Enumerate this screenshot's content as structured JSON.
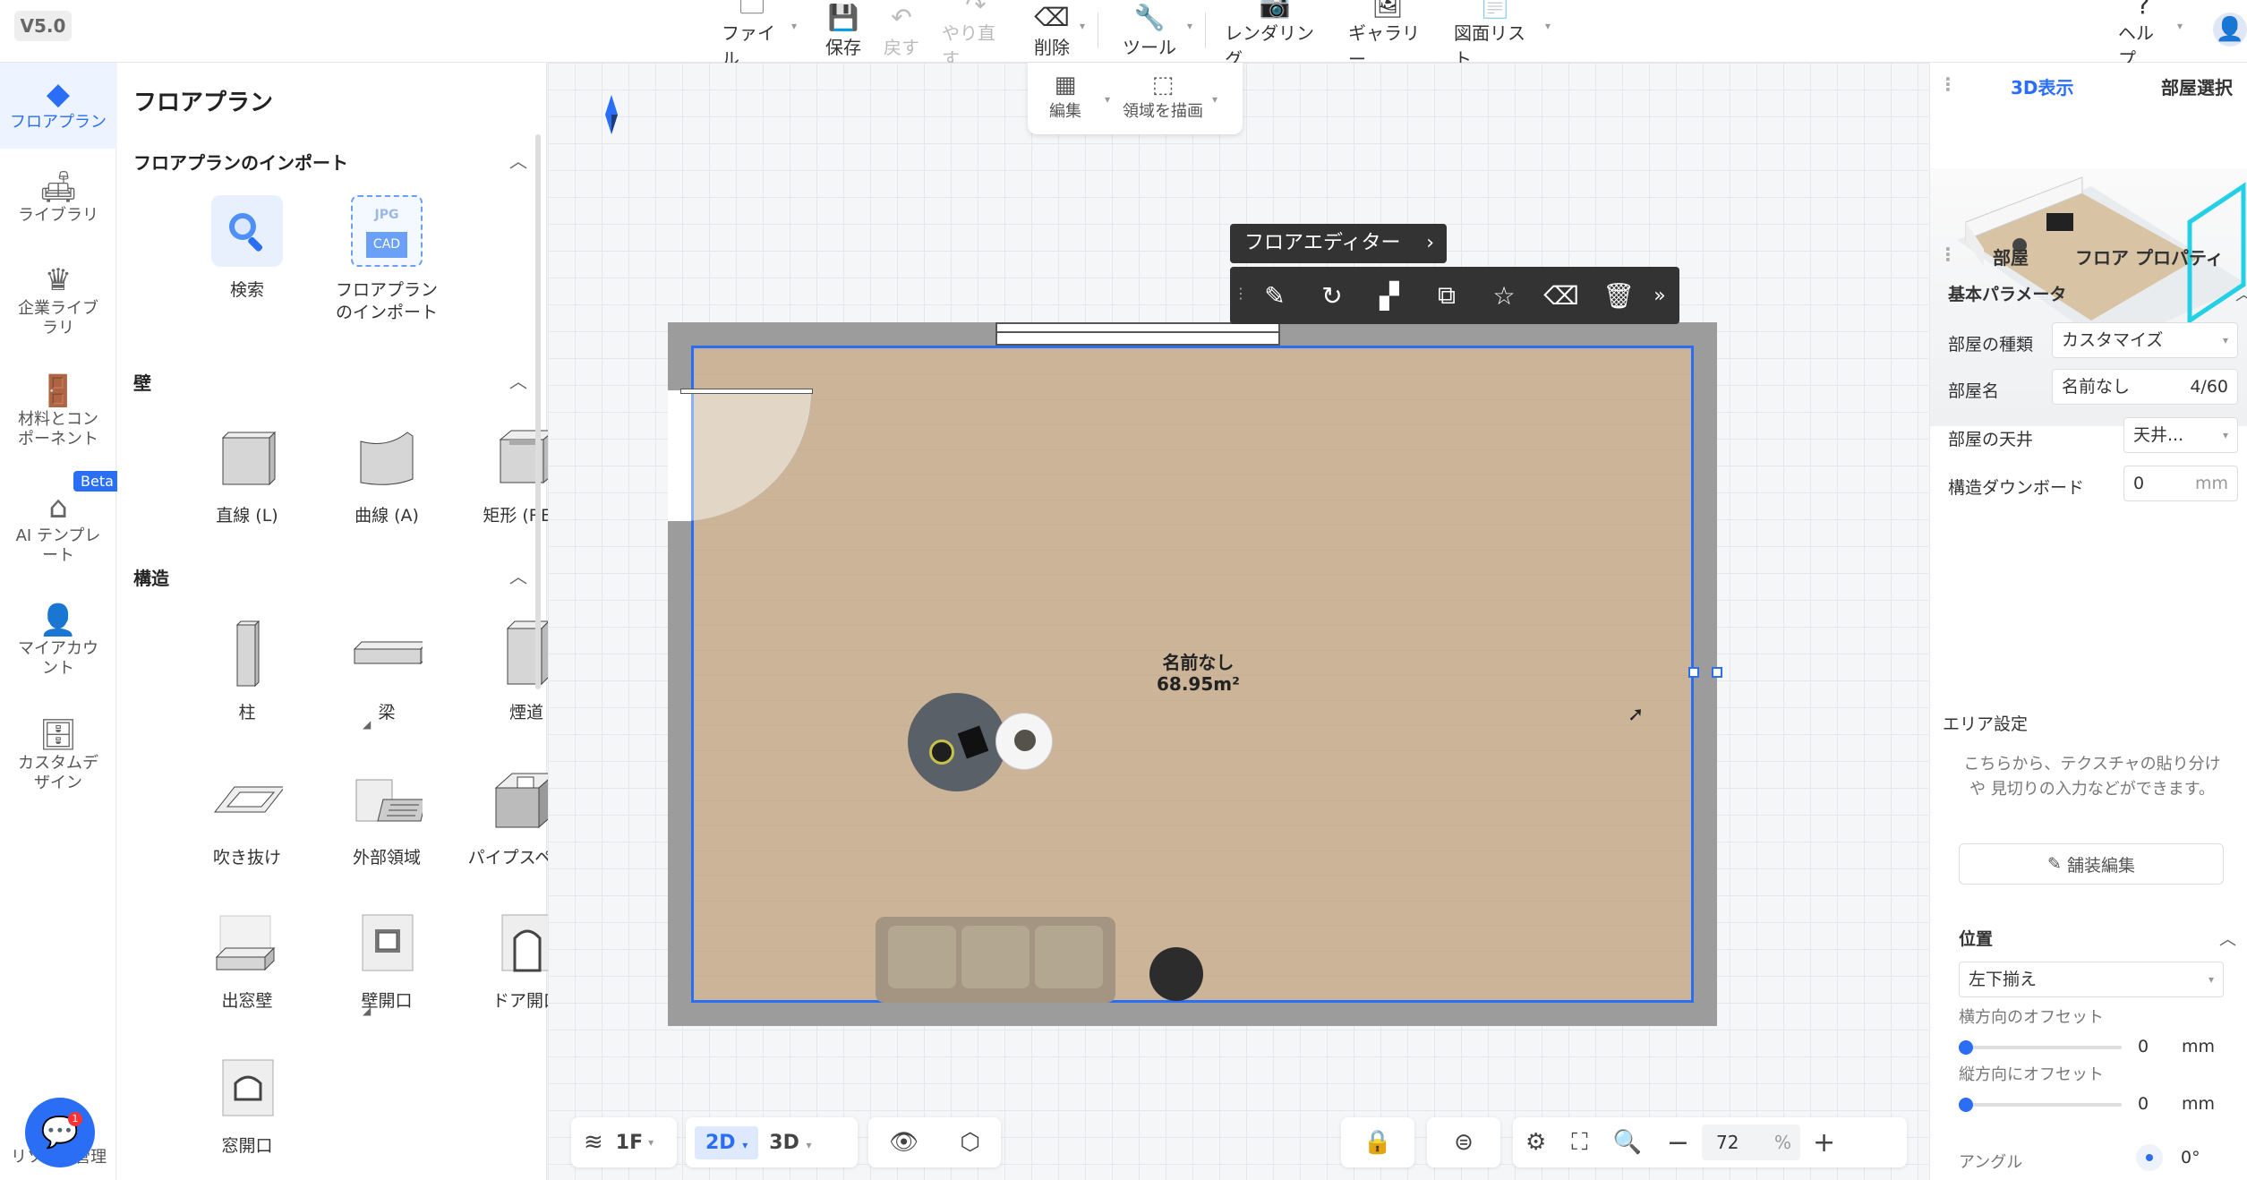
{
  "version": "V5.0",
  "toolbar": {
    "file": "ファイル",
    "save": "保存",
    "undo": "戻す",
    "redo": "やり直す",
    "delete": "削除",
    "tools": "ツール",
    "render": "レンダリング",
    "gallery": "ギャラリー",
    "drawings": "図面リスト",
    "help": "ヘルプ"
  },
  "sidebar": {
    "items": [
      {
        "label": "フロアプラン"
      },
      {
        "label": "ライブラリ"
      },
      {
        "label": "企業ライブラリ"
      },
      {
        "label": "材料とコンポーネント"
      },
      {
        "label": "AI テンプレート"
      },
      {
        "label": "マイアカウント"
      },
      {
        "label": "カスタムデザイン"
      }
    ],
    "beta": "Beta",
    "bottom_label": "リソース管理",
    "chat_badge": "1"
  },
  "library": {
    "title": "フロアプラン",
    "import_section": "フロアプランのインポート",
    "search": "検索",
    "import": "フロアプランのインポート",
    "jpg": "JPG",
    "cad": "CAD",
    "wall_section": "壁",
    "walls": [
      "直線 (L)",
      "曲線 (A)",
      "矩形 (REC)"
    ],
    "structure_section": "構造",
    "structures": [
      "柱",
      "梁",
      "煙道",
      "吹き抜け",
      "外部領域",
      "パイプスペース",
      "出窓壁",
      "壁開口",
      "ドア開口",
      "窓開口"
    ]
  },
  "canvas_tools": {
    "edit": "編集",
    "draw_area": "領域を描画"
  },
  "floor_editor": {
    "label": "フロアエディター"
  },
  "room": {
    "name": "名前なし",
    "area": "68.95m²"
  },
  "bottom": {
    "floor": "1F",
    "view2d": "2D",
    "view3d": "3D",
    "zoom": "72",
    "zoom_unit": "%"
  },
  "right": {
    "tab_3d": "3D表示",
    "tab_room_select": "部屋選択",
    "tab_room": "部屋",
    "tab_floor_props": "フロア プロパティ",
    "basic_params": "基本パラメータ",
    "room_type_label": "部屋の種類",
    "room_type_value": "カスタマイズ",
    "room_name_label": "部屋名",
    "room_name_value": "名前なし",
    "room_name_count": "4/60",
    "ceiling_label": "部屋の天井",
    "ceiling_value": "天井...",
    "downboard_label": "構造ダウンボード",
    "downboard_value": "0",
    "downboard_unit": "mm",
    "area_settings": "エリア設定",
    "area_hint": "こちらから、テクスチャの貼り分けや 見切りの入力などができます。",
    "pave_edit": "舗装編集",
    "position": "位置",
    "align_value": "左下揃え",
    "h_offset_label": "横方向のオフセット",
    "h_offset_value": "0",
    "h_offset_unit": "mm",
    "v_offset_label": "縦方向にオフセット",
    "v_offset_value": "0",
    "v_offset_unit": "mm",
    "angle_label": "アングル",
    "angle_value": "0°"
  }
}
